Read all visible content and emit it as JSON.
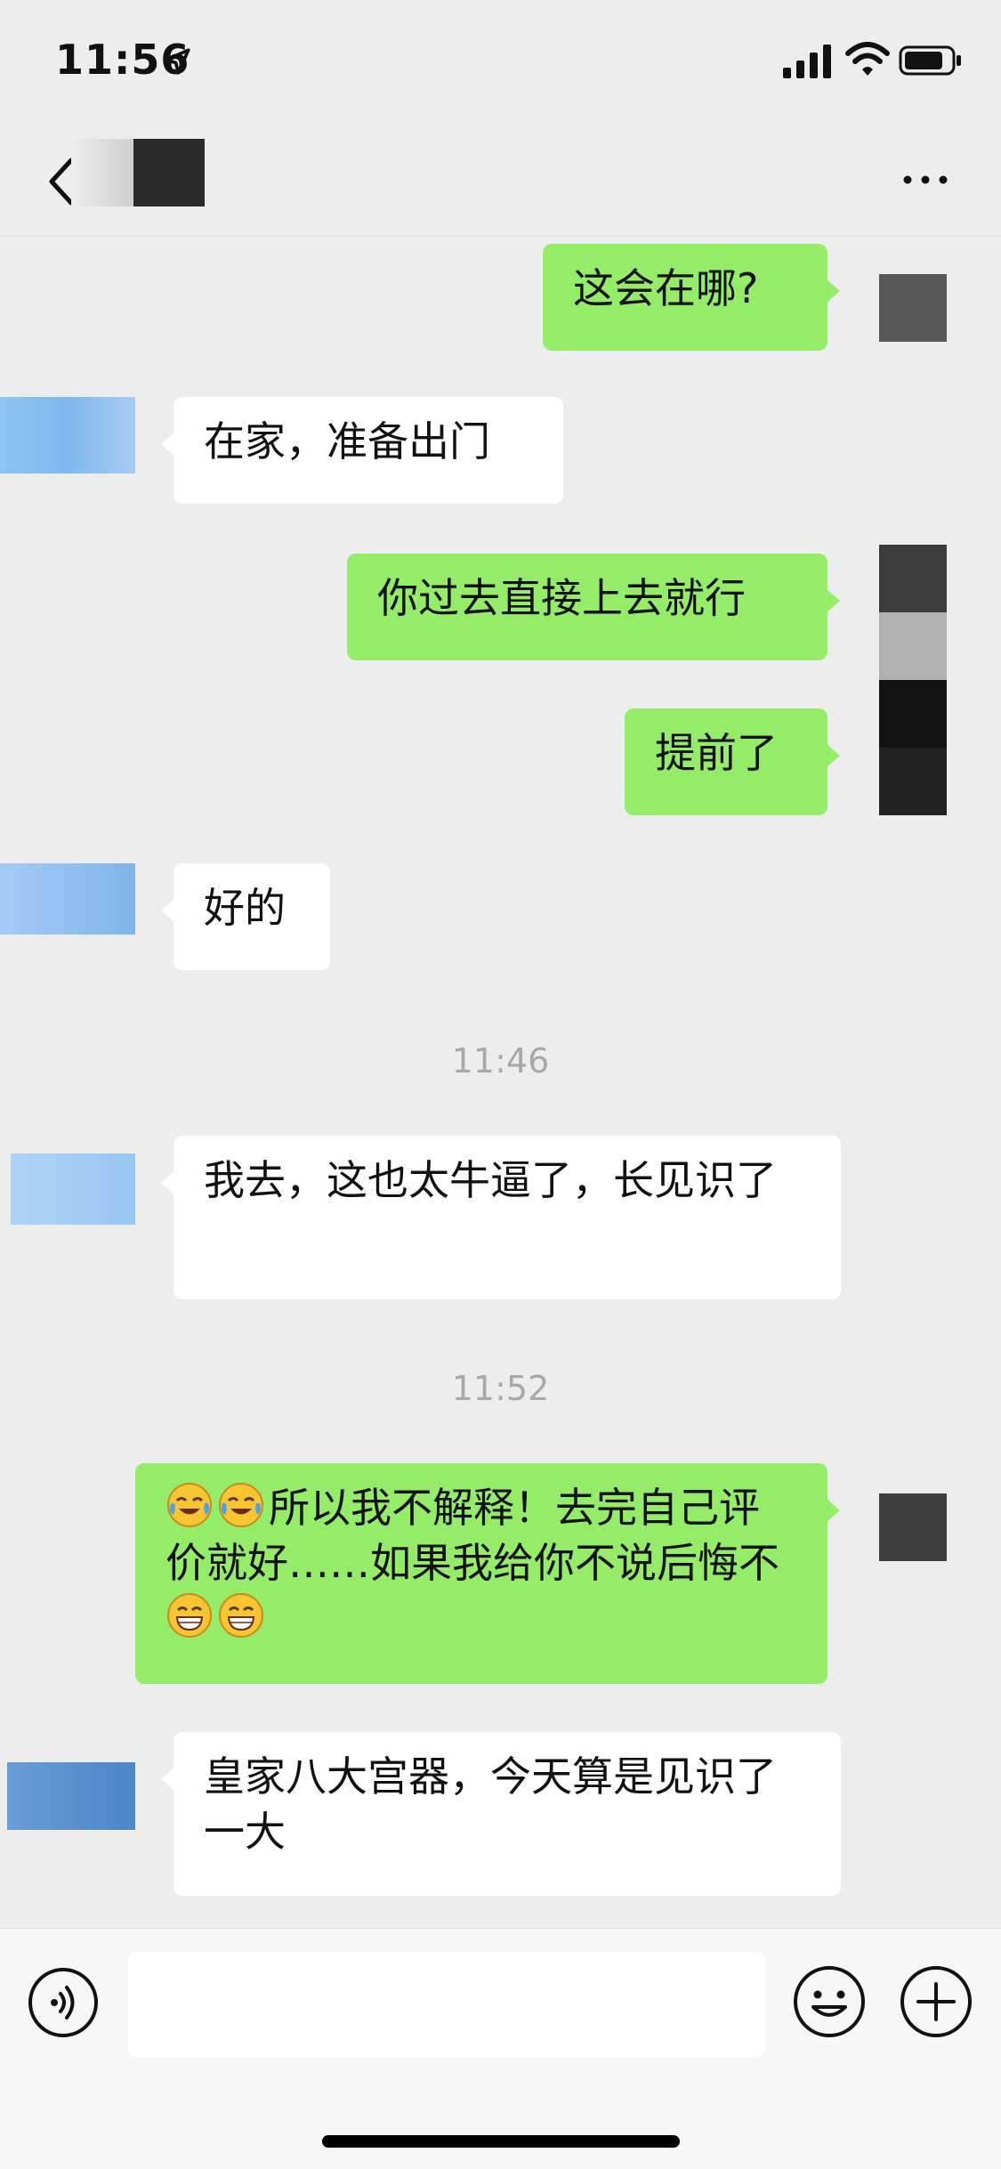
{
  "status_bar": {
    "time": "11:56"
  },
  "nav": {
    "title": ""
  },
  "messages": [
    {
      "id": "m1",
      "side": "out",
      "text": "这会在哪?"
    },
    {
      "id": "m2",
      "side": "in",
      "text": "在家，准备出门"
    },
    {
      "id": "m3",
      "side": "out",
      "text": "你过去直接上去就行"
    },
    {
      "id": "m4",
      "side": "out",
      "text": "提前了"
    },
    {
      "id": "m5",
      "side": "in",
      "text": "好的"
    },
    {
      "id": "t1",
      "type": "timestamp",
      "text": "11:46"
    },
    {
      "id": "m6",
      "side": "in",
      "text": "我去，这也太牛逼了，长见识了"
    },
    {
      "id": "t2",
      "type": "timestamp",
      "text": "11:52"
    },
    {
      "id": "m7",
      "side": "out",
      "emoji_prefix": [
        "crying-laughing-emoji",
        "crying-laughing-emoji"
      ],
      "text": "所以我不解释！去完自己评价就好……如果我给你不说后悔不",
      "emoji_suffix": [
        "grin-emoji",
        "grin-emoji"
      ]
    },
    {
      "id": "m8",
      "side": "in",
      "text": "皇家八大宫器，今天算是见识了一大"
    }
  ],
  "input_bar": {
    "placeholder": ""
  },
  "colors": {
    "out_bubble": "#95ec69",
    "in_bubble": "#ffffff",
    "background": "#ededed"
  }
}
